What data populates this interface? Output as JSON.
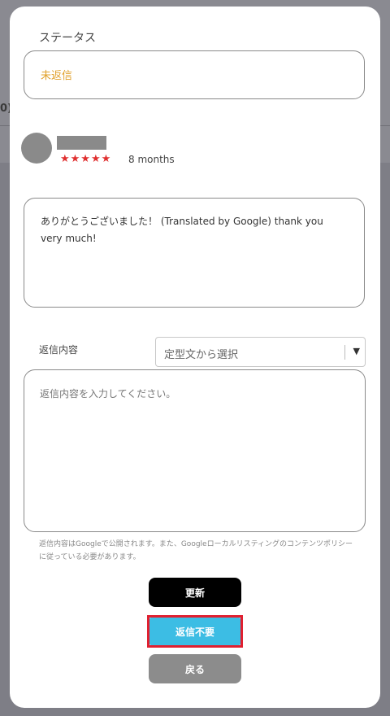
{
  "background": {
    "partial_text": "0)"
  },
  "status": {
    "label": "ステータス",
    "value": "未返信"
  },
  "review": {
    "stars": "★★★★★",
    "rating": 5,
    "date": "8 months",
    "text": "ありがとうございました！ (Translated by Google) thank you very much!"
  },
  "reply": {
    "label": "返信内容",
    "template_select": "定型文から選択",
    "placeholder": "返信内容を入力してください。",
    "notice": "返信内容はGoogleで公開されます。また、Googleローカルリスティングのコンテンツポリシーに従っている必要があります。"
  },
  "buttons": {
    "update": "更新",
    "no_reply": "返信不要",
    "back": "戻る"
  },
  "colors": {
    "status_value": "#e0a02a",
    "stars": "#e03030",
    "update_btn": "#000000",
    "no_reply_btn": "#3cbde4",
    "back_btn": "#8c8c8c",
    "highlight": "#e02030"
  },
  "icons": {
    "select_arrow": "chevron-down-icon"
  }
}
